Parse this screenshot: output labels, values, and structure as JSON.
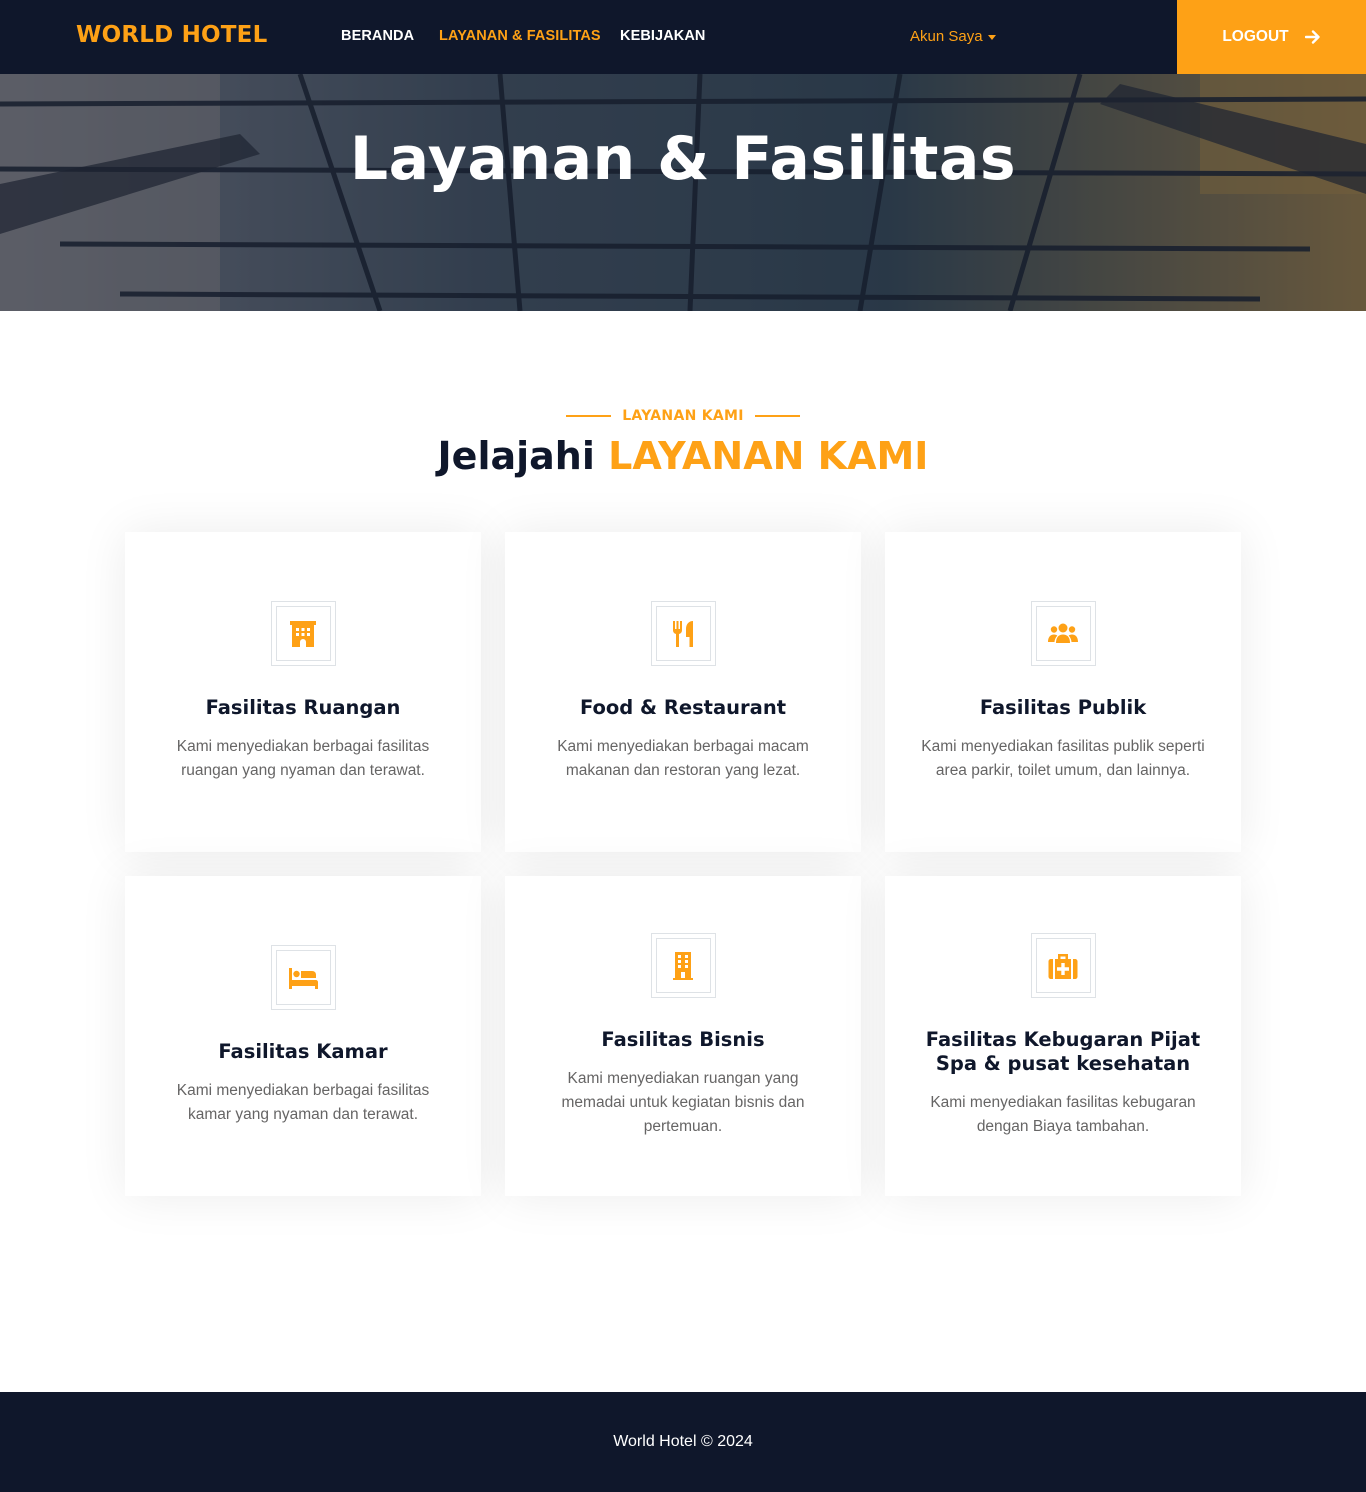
{
  "navbar": {
    "brand": "WORLD HOTEL",
    "links": [
      {
        "label": "BERANDA",
        "active": false
      },
      {
        "label": "LAYANAN & FASILITAS",
        "active": true
      },
      {
        "label": "KEBIJAKAN",
        "active": false
      }
    ],
    "account_label": "Akun Saya",
    "logout_label": "LOGOUT",
    "logout_icon": "arrow-right-icon"
  },
  "hero": {
    "title": "Layanan & Fasilitas"
  },
  "section": {
    "subtitle": "LAYANAN KAMI",
    "title_prefix": "Jelajahi",
    "title_accent": "LAYANAN KAMI"
  },
  "services": [
    {
      "icon": "hotel-icon",
      "title": "Fasilitas Ruangan",
      "text": "Kami menyediakan berbagai fasilitas ruangan yang nyaman dan terawat."
    },
    {
      "icon": "utensils-icon",
      "title": "Food & Restaurant",
      "text": "Kami menyediakan berbagai macam makanan dan restoran yang lezat."
    },
    {
      "icon": "users-icon",
      "title": "Fasilitas Publik",
      "text": "Kami menyediakan fasilitas publik seperti area parkir, toilet umum, dan lainnya."
    },
    {
      "icon": "bed-icon",
      "title": "Fasilitas Kamar",
      "text": "Kami menyediakan berbagai fasilitas kamar yang nyaman dan terawat."
    },
    {
      "icon": "building-icon",
      "title": "Fasilitas Bisnis",
      "text": "Kami menyediakan ruangan yang memadai untuk kegiatan bisnis dan pertemuan."
    },
    {
      "icon": "medkit-icon",
      "title": "Fasilitas Kebugaran Pijat Spa & pusat kesehatan",
      "text": "Kami menyediakan fasilitas kebugaran dengan Biaya tambahan."
    }
  ],
  "footer": {
    "text": "World Hotel © 2024"
  },
  "colors": {
    "primary": "#fea116",
    "dark": "#0f172b",
    "body_text": "#666565"
  }
}
